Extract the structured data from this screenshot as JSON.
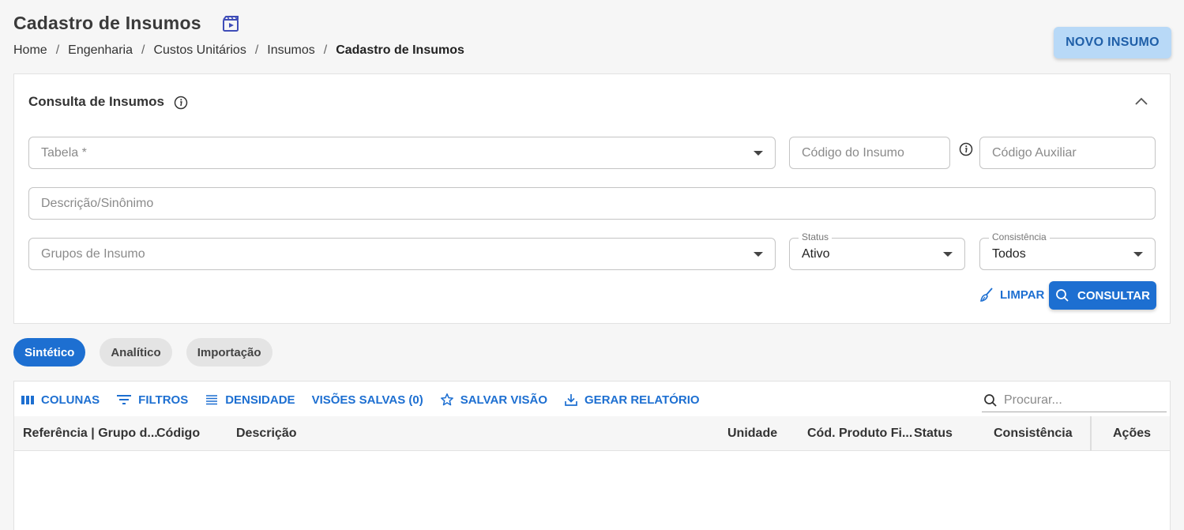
{
  "page": {
    "title": "Cadastro de Insumos",
    "title_icon": "video-tutorial-icon",
    "breadcrumb": [
      "Home",
      "Engenharia",
      "Custos Unitários",
      "Insumos",
      "Cadastro de Insumos"
    ],
    "breadcrumb_separator": "/",
    "new_button": "NOVO INSUMO"
  },
  "filters": {
    "title": "Consulta de Insumos",
    "tabela_placeholder": "Tabela *",
    "codigo_insumo_placeholder": "Código do Insumo",
    "codigo_auxiliar_placeholder": "Código Auxiliar",
    "descricao_placeholder": "Descrição/Sinônimo",
    "grupos_placeholder": "Grupos de Insumo",
    "status_label": "Status",
    "status_value": "Ativo",
    "consistencia_label": "Consistência",
    "consistencia_value": "Todos",
    "clear_button": "LIMPAR",
    "search_button": "CONSULTAR"
  },
  "view_tabs": [
    {
      "label": "Sintético",
      "active": true
    },
    {
      "label": "Analítico",
      "active": false
    },
    {
      "label": "Importação",
      "active": false
    }
  ],
  "grid": {
    "toolbar": {
      "columns": "COLUNAS",
      "filters": "FILTROS",
      "density": "DENSIDADE",
      "saved_views": "VISÕES SALVAS (0)",
      "save_view": "SALVAR VISÃO",
      "report": "GERAR RELATÓRIO"
    },
    "search_placeholder": "Procurar...",
    "columns": [
      "Referência | Grupo d...",
      "Código",
      "Descrição",
      "Unidade",
      "Cód. Produto Fi...",
      "Status",
      "Consistência",
      "Ações"
    ]
  },
  "colors": {
    "accent": "#1d6fd1",
    "accent_light": "#b8d9f7",
    "background": "#f6f6f6"
  }
}
